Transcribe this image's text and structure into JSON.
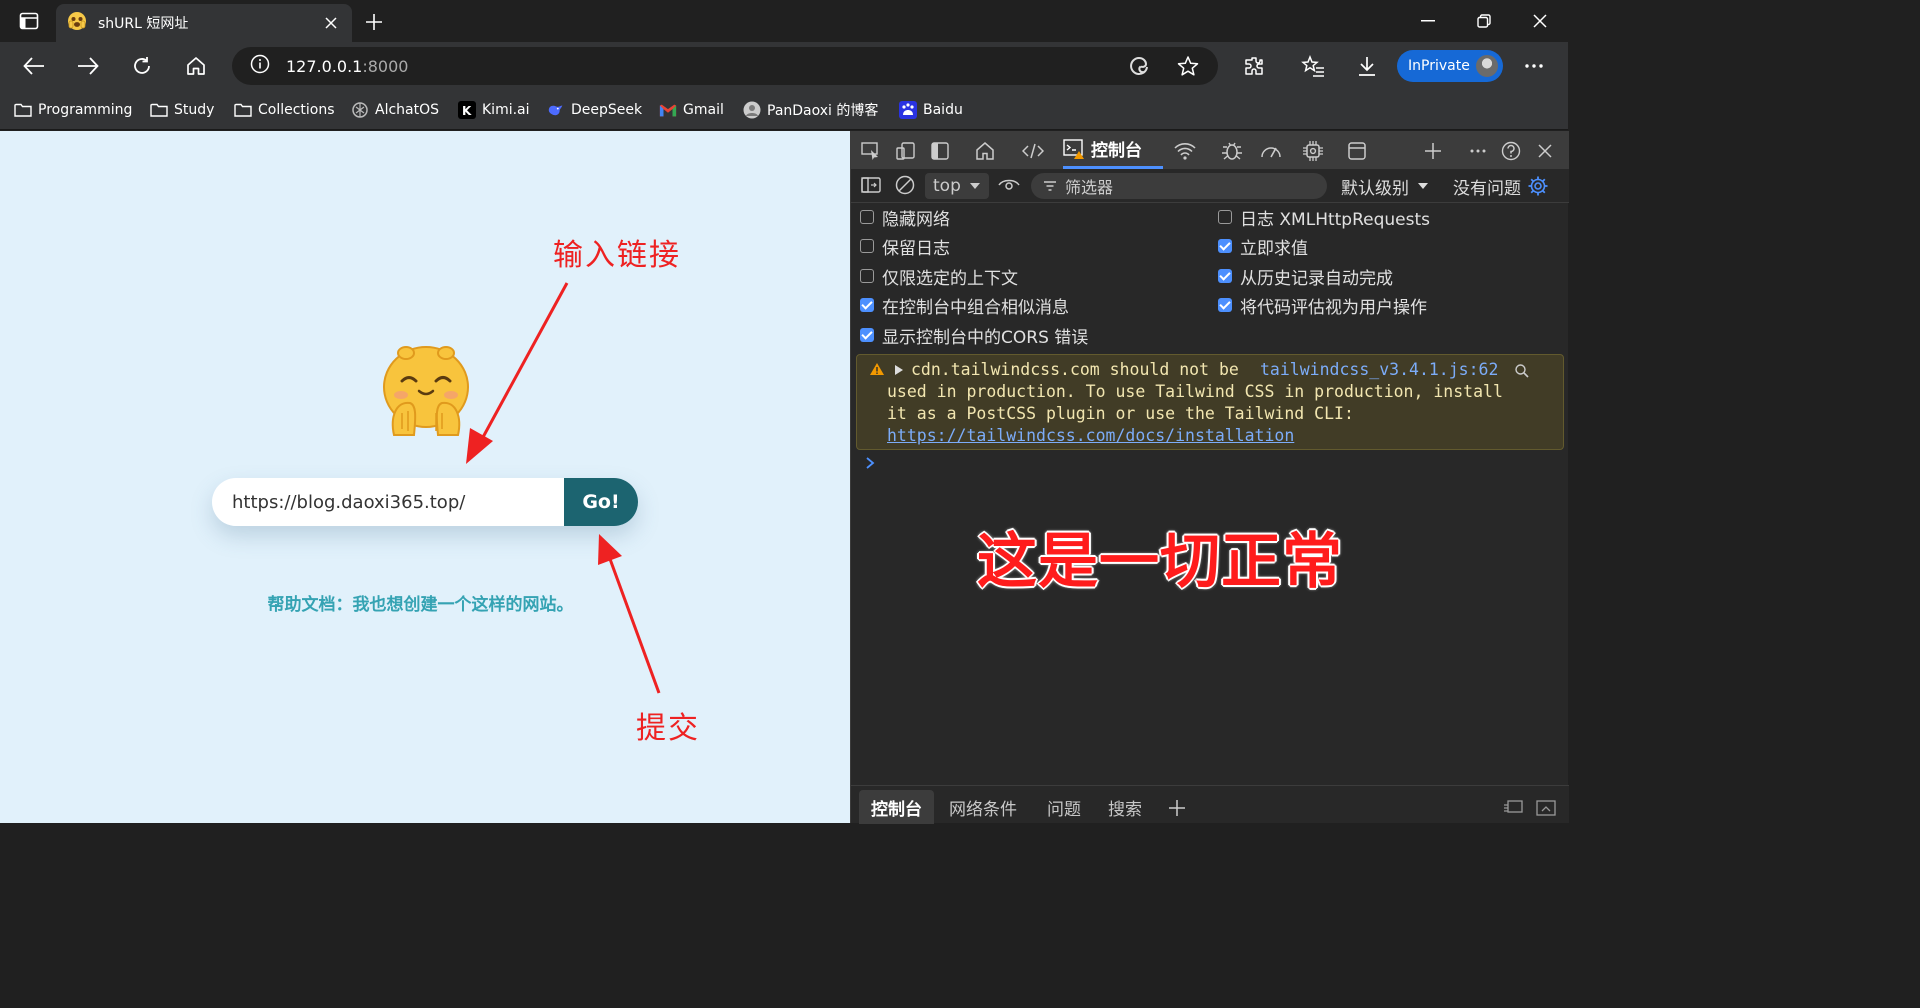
{
  "browser": {
    "tab": {
      "title": "shURL 短网址"
    },
    "address": {
      "host": "127.0.0.1",
      "port": ":8000"
    },
    "inprivate_label": "InPrivate",
    "bookmarks": [
      {
        "label": "Programming",
        "icon": "folder-icon"
      },
      {
        "label": "Study",
        "icon": "folder-icon"
      },
      {
        "label": "Collections",
        "icon": "folder-icon"
      },
      {
        "label": "AlchatOS",
        "icon": "openai-icon"
      },
      {
        "label": "Kimi.ai",
        "icon": "kimi-icon"
      },
      {
        "label": "DeepSeek",
        "icon": "deepseek-icon"
      },
      {
        "label": "Gmail",
        "icon": "gmail-icon"
      },
      {
        "label": "PanDaoxi 的博客",
        "icon": "blog-avatar-icon"
      },
      {
        "label": "Baidu",
        "icon": "baidu-icon"
      }
    ]
  },
  "page": {
    "url_input_value": "https://blog.daoxi365.top/",
    "go_label": "Go!",
    "help_text": "帮助文档：我也想创建一个这样的网站。",
    "annotation_input": "输入链接",
    "annotation_submit": "提交",
    "colors": {
      "background": "#e1f1fb",
      "button": "#1c6470",
      "help": "#35a3b3",
      "annotation": "#ee2222"
    }
  },
  "devtools": {
    "active_tab": "控制台",
    "context": "top",
    "filter_placeholder": "筛选器",
    "levels": "默认级别",
    "issues": "没有问题",
    "settings": [
      {
        "label": "隐藏网络",
        "checked": false
      },
      {
        "label": "保留日志",
        "checked": false
      },
      {
        "label": "仅限选定的上下文",
        "checked": false
      },
      {
        "label": "在控制台中组合相似消息",
        "checked": true
      },
      {
        "label": "显示控制台中的CORS 错误",
        "checked": true
      },
      {
        "label": "日志 XMLHttpRequests",
        "checked": false
      },
      {
        "label": "立即求值",
        "checked": true
      },
      {
        "label": "从历史记录自动完成",
        "checked": true
      },
      {
        "label": "将代码评估视为用户操作",
        "checked": true
      }
    ],
    "warning": {
      "line1": "cdn.tailwindcss.com should not be",
      "source": "tailwindcss_v3.4.1.js:62",
      "line2": "used in production. To use Tailwind CSS in production, install",
      "line3": "it as a PostCSS plugin or use the Tailwind CLI:",
      "link": "https://tailwindcss.com/docs/installation"
    },
    "annotation_normal": "这是一切正常",
    "drawer_tabs": [
      "控制台",
      "网络条件",
      "问题",
      "搜索"
    ]
  }
}
